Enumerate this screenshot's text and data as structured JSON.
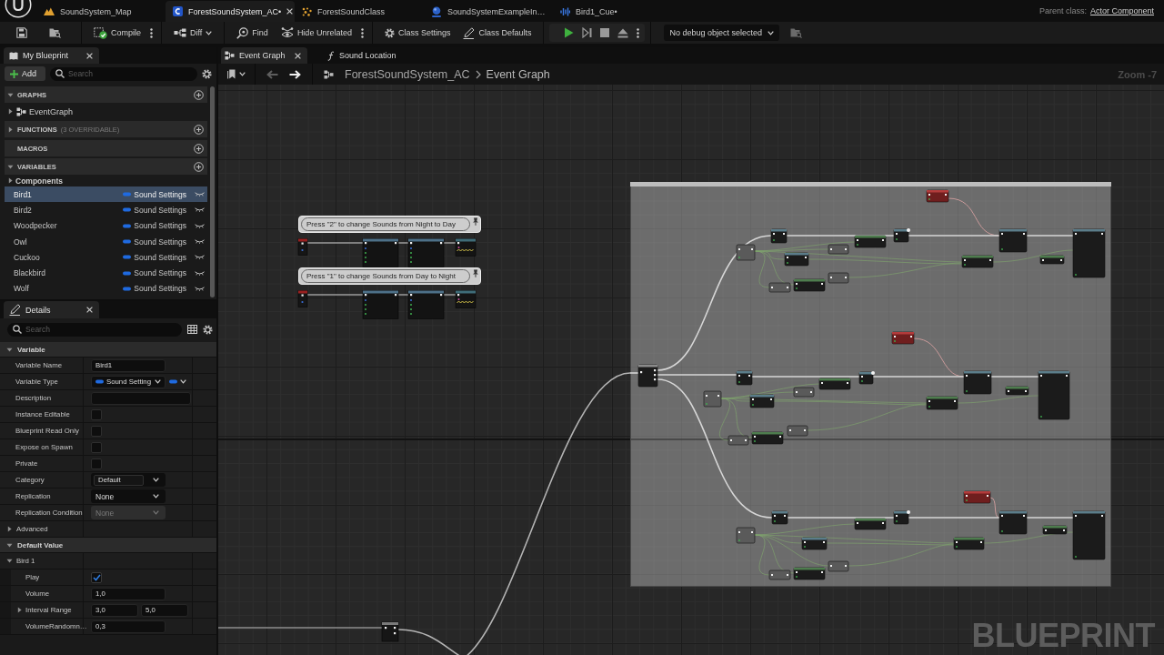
{
  "title_bar": {
    "tabs": [
      {
        "label": "SoundSystem_Map",
        "kind": "map",
        "selected": false
      },
      {
        "label": "ForestSoundSystem_AC•",
        "kind": "blueprint",
        "selected": true
      },
      {
        "label": "ForestSoundClass",
        "kind": "class",
        "selected": false
      },
      {
        "label": "SoundSystemExampleIn…",
        "kind": "instance",
        "selected": false
      },
      {
        "label": "Bird1_Cue•",
        "kind": "cue",
        "selected": false
      }
    ],
    "parent_class_label": "Parent class:",
    "parent_class": "Actor Component"
  },
  "toolbar": {
    "buttons": [
      {
        "label": "Compile",
        "kind": "compile"
      },
      {
        "label": "Diff",
        "kind": "diff"
      },
      {
        "label": "Find",
        "kind": "find"
      },
      {
        "label": "Hide Unrelated",
        "kind": "hide"
      },
      {
        "label": "Class Settings",
        "kind": "settings"
      },
      {
        "label": "Class Defaults",
        "kind": "defaults"
      }
    ],
    "debug_object": "No debug object selected"
  },
  "my_blueprint": {
    "tab": "My Blueprint",
    "add_button": "Add",
    "search_placeholder": "Search",
    "sections": [
      {
        "title": "GRAPHS",
        "expanded": true,
        "items": [
          {
            "label": "EventGraph",
            "expanded": false
          }
        ]
      },
      {
        "title": "FUNCTIONS",
        "note": "(3 OVERRIDABLE)",
        "expanded": false
      },
      {
        "title": "MACROS"
      },
      {
        "title": "VARIABLES",
        "expanded": true,
        "category": {
          "label": "Components",
          "expanded": false
        },
        "variables": [
          {
            "name": "Bird1",
            "type": "Sound Settings",
            "selected": true
          },
          {
            "name": "Bird2",
            "type": "Sound Settings",
            "selected": false
          },
          {
            "name": "Woodpecker",
            "type": "Sound Settings",
            "selected": false
          },
          {
            "name": "Owl",
            "type": "Sound Settings",
            "selected": false
          },
          {
            "name": "Cuckoo",
            "type": "Sound Settings",
            "selected": false
          },
          {
            "name": "Blackbird",
            "type": "Sound Settings",
            "selected": false
          },
          {
            "name": "Wolf",
            "type": "Sound Settings",
            "selected": false
          }
        ]
      }
    ]
  },
  "details": {
    "tab": "Details",
    "search_placeholder": "Search",
    "sections": [
      {
        "title": "Variable",
        "kind": "category",
        "expanded": true,
        "rows": [
          {
            "label": "Variable Name",
            "kind": "text",
            "value": "Bird1"
          },
          {
            "label": "Variable Type",
            "kind": "type",
            "value": "Sound Setting"
          },
          {
            "label": "Description",
            "kind": "multiline"
          },
          {
            "label": "Instance Editable",
            "kind": "checkbox",
            "checked": false
          },
          {
            "label": "Blueprint Read Only",
            "kind": "checkbox",
            "checked": false
          },
          {
            "label": "Expose on Spawn",
            "kind": "checkbox",
            "checked": false
          },
          {
            "label": "Private",
            "kind": "checkbox",
            "checked": false
          },
          {
            "label": "Category",
            "kind": "combo",
            "value": "Default"
          },
          {
            "label": "Replication",
            "kind": "select",
            "value": "None",
            "disabled": false
          },
          {
            "label": "Replication Condition",
            "kind": "select",
            "value": "None",
            "disabled": true
          }
        ]
      },
      {
        "title": "Advanced",
        "kind": "subcategory",
        "expanded": false
      },
      {
        "title": "Default Value",
        "kind": "category",
        "expanded": true,
        "groups": [
          {
            "label": "Bird 1",
            "expanded": true,
            "rows": [
              {
                "label": "Play",
                "kind": "checkbox",
                "checked": true
              },
              {
                "label": "Volume",
                "kind": "text",
                "value": "1,0"
              },
              {
                "label": "Interval Range",
                "kind": "range",
                "expanded": false,
                "values": [
                  "3,0",
                  "5,0"
                ]
              },
              {
                "label": "VolumeRandomn…",
                "kind": "text",
                "value": "0,3"
              }
            ]
          }
        ]
      }
    ]
  },
  "graph": {
    "tabs": [
      {
        "label": "Event Graph",
        "kind": "graph",
        "selected": true
      },
      {
        "label": "Sound Location",
        "kind": "function",
        "selected": false
      }
    ],
    "navigation": {
      "back_disabled": true,
      "forward_disabled": false
    },
    "breadcrumb": [
      "ForestSoundSystem_AC",
      "Event Graph"
    ],
    "zoom": "Zoom -7",
    "comments": [
      {
        "text": "Press \"2\" to change Sounds from Night to Day"
      },
      {
        "text": "Press \"1\" to change Sounds from Day to Night"
      }
    ],
    "graph_type": "BLUEPRINT"
  }
}
